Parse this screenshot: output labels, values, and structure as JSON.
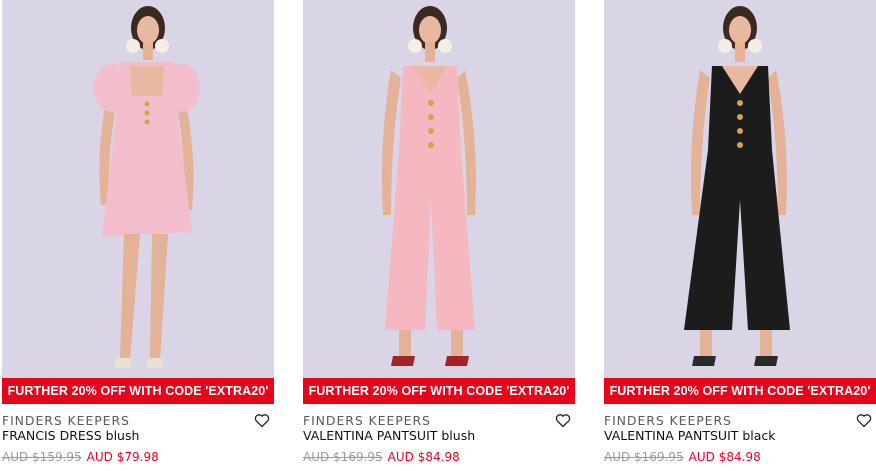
{
  "products": [
    {
      "promo": "FURTHER 20% OFF WITH CODE 'EXTRA20'",
      "brand": "FINDERS KEEPERS",
      "name": "FRANCIS DRESS blush",
      "was_price": "AUD $159.95",
      "price": "AUD $79.98",
      "image_icon": "model-photo-dress",
      "garment_color": "#f4bdcc"
    },
    {
      "promo": "FURTHER 20% OFF WITH CODE 'EXTRA20'",
      "brand": "FINDERS KEEPERS",
      "name": "VALENTINA PANTSUIT blush",
      "was_price": "AUD $169.95",
      "price": "AUD $84.98",
      "image_icon": "model-photo-pantsuit",
      "garment_color": "#f6b8c0"
    },
    {
      "promo": "FURTHER 20% OFF WITH CODE 'EXTRA20'",
      "brand": "FINDERS KEEPERS",
      "name": "VALENTINA PANTSUIT black",
      "was_price": "AUD $169.95",
      "price": "AUD $84.98",
      "image_icon": "model-photo-pantsuit",
      "garment_color": "#1c1c1c"
    }
  ],
  "colors": {
    "promo_bg": "#e8051b",
    "sale_price": "#e8051b",
    "photo_bg": "#d9d4e6"
  },
  "wishlist_icon": "heart-outline-icon"
}
